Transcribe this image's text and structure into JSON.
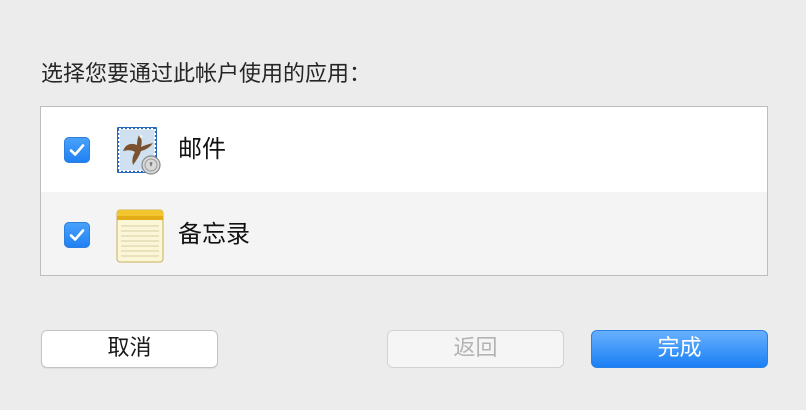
{
  "dialog": {
    "prompt": "选择您要通过此帐户使用的应用："
  },
  "apps": [
    {
      "label": "邮件",
      "checked": true,
      "icon": "mail-app-icon"
    },
    {
      "label": "备忘录",
      "checked": true,
      "icon": "notes-app-icon"
    }
  ],
  "buttons": {
    "cancel": "取消",
    "back": "返回",
    "done": "完成"
  },
  "colors": {
    "accent": "#1e7ff2",
    "window_background": "#ececec",
    "disabled_text": "#b4b4b4"
  }
}
